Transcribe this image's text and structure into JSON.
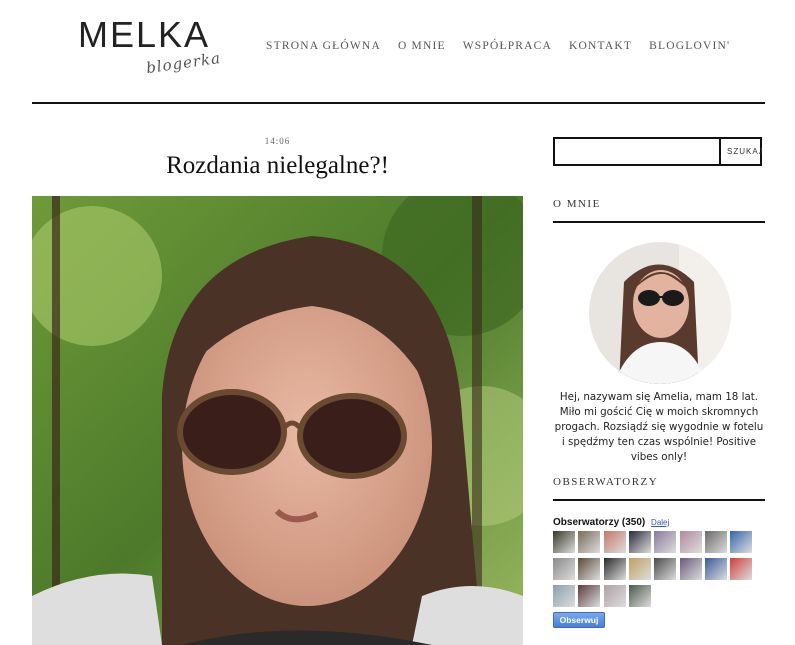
{
  "logo": {
    "main": "MELKA",
    "script": "blogerka"
  },
  "nav": [
    "STRONA GŁÓWNA",
    "O MNIE",
    "WSPÓŁPRACA",
    "KONTAKT",
    "BLOGLOVIN'"
  ],
  "post": {
    "time": "14:06",
    "title": "Rozdania nielegalne?!"
  },
  "search": {
    "placeholder": "",
    "button": "SZUKAJ"
  },
  "about": {
    "title": "O MNIE",
    "text": "Hej, nazywam się Amelia, mam 18 lat. Miło mi gościć Cię w moich skromnych progach. Rozsiądź się wygodnie w fotelu i spędźmy ten czas wspólnie! Positive vibes only!"
  },
  "followers": {
    "title": "OBSERWATORZY",
    "label": "Obserwatorzy (350)",
    "more": "Dalej",
    "follow_button": "Obserwuj",
    "thumb_colors": [
      "#3a3a2a",
      "#7a6a5a",
      "#c07a6a",
      "#2a2a3a",
      "#8a7a9a",
      "#b08aa0",
      "#6a6a6a",
      "#3366aa",
      "#8a8a8a",
      "#5a4a3a",
      "#2a2a2a",
      "#c0a060",
      "#4a4a4a",
      "#6a5a7a",
      "#3a5a9a",
      "#d04040",
      "#8aa0b0",
      "#5a3a3a",
      "#b0a0a8",
      "#4a5a4a"
    ]
  },
  "colors": {
    "accent": "#111111",
    "link": "#3355cc",
    "button": "#4a7fd6"
  }
}
